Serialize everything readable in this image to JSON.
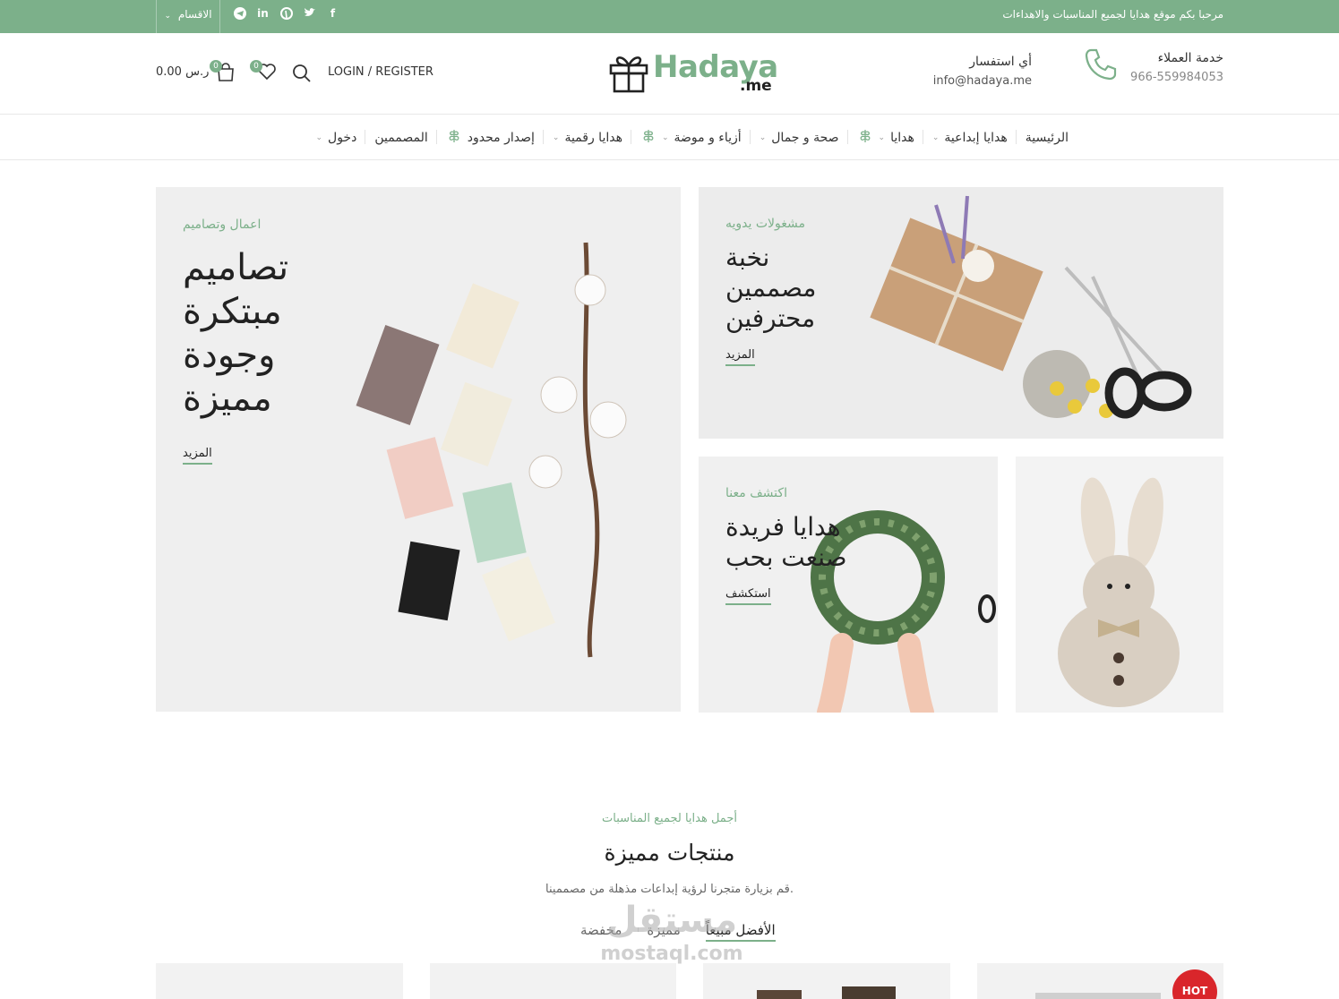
{
  "topbar": {
    "welcome": "مرحبا بكم  موقع هدايا لجميع المناسبات والاهداءات",
    "categories_label": "الاقسام",
    "social_icons": [
      "facebook-icon",
      "twitter-icon",
      "pinterest-icon",
      "linkedin-icon",
      "telegram-icon"
    ]
  },
  "header": {
    "logo_text": "Hadaya",
    "logo_tld": ".me",
    "customer_service_title": "خدمة العملاء",
    "customer_service_phone": "966-559984053",
    "inquiry_title": "أي استفسار",
    "inquiry_email": "info@hadaya.me",
    "login_label": "LOGIN / REGISTER",
    "wishlist_count": "0",
    "cart_count": "0",
    "cart_total": "0.00 ر.س"
  },
  "nav": {
    "items": [
      {
        "label": "الرئيسية",
        "has_dropdown": false,
        "has_leaf_icon": false
      },
      {
        "label": "هدايا إبداعية",
        "has_dropdown": true,
        "has_leaf_icon": false
      },
      {
        "label": "هدايا",
        "has_dropdown": true,
        "has_leaf_icon": true
      },
      {
        "label": "صحة و جمال",
        "has_dropdown": true,
        "has_leaf_icon": false
      },
      {
        "label": "أزياء و موضة",
        "has_dropdown": true,
        "has_leaf_icon": true
      },
      {
        "label": "هدايا رقمية",
        "has_dropdown": true,
        "has_leaf_icon": false
      },
      {
        "label": "إصدار محدود",
        "has_dropdown": false,
        "has_leaf_icon": true
      },
      {
        "label": "المصممين",
        "has_dropdown": false,
        "has_leaf_icon": false
      },
      {
        "label": "دخول",
        "has_dropdown": true,
        "has_leaf_icon": false
      }
    ]
  },
  "banners": {
    "main": {
      "subtitle": "اعمال وتصاميم",
      "title_lines": [
        "تصاميم",
        "مبتكرة",
        "وجودة",
        "مميزة"
      ],
      "link": "المزيد"
    },
    "crafts": {
      "subtitle": "مشغولات يدويه",
      "title_lines": [
        "نخبة",
        "مصممين",
        "محترفين"
      ],
      "link": "المزيد"
    },
    "discover": {
      "subtitle": "اكتشف معنا",
      "title_lines": [
        "هدايا فريدة",
        "صنعت بحب"
      ],
      "link": "استكشف"
    }
  },
  "featured": {
    "subtitle": "أجمل هدايا لجميع المناسبات",
    "title": "منتجات مميزة",
    "description": "قم بزيارة متجرنا لرؤية إبداعات مذهلة من مصممينا.",
    "tabs": [
      "الأفضل مبيعاً",
      "مميزة",
      "مخفضة"
    ],
    "active_tab": "الأفضل مبيعاً",
    "hot_label": "HOT"
  },
  "watermark": {
    "arabic": "مستقل",
    "latin": "mostaql.com"
  },
  "colors": {
    "accent": "#7cb08a",
    "hot": "#d9262b"
  }
}
